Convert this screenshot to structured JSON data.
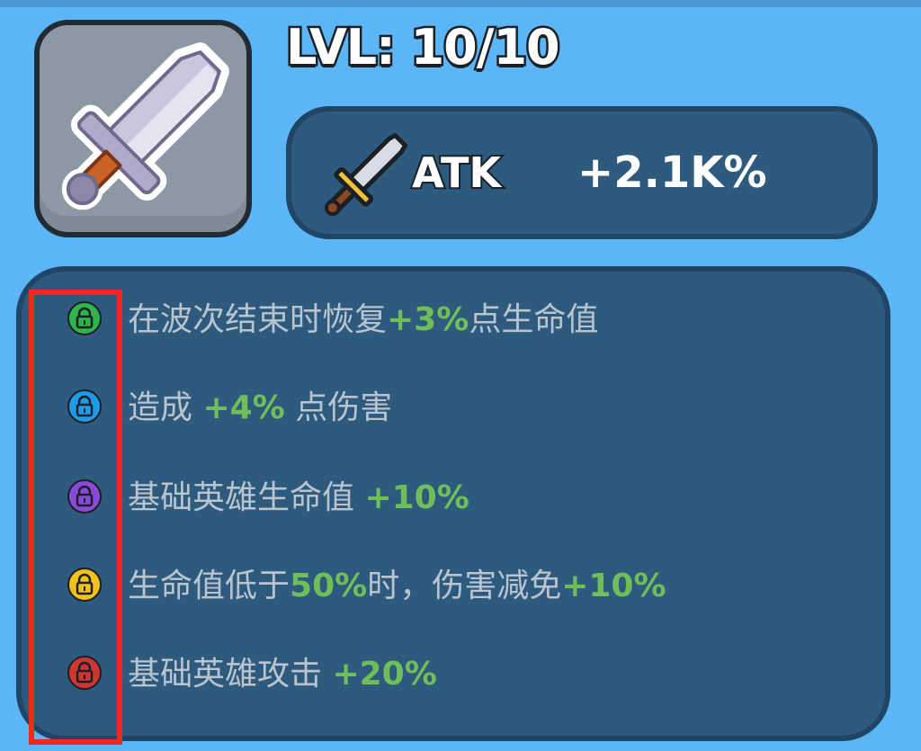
{
  "item": {
    "icon": "sword-icon"
  },
  "level": {
    "label": "LVL: 10/10"
  },
  "stat": {
    "icon": "small-sword-icon",
    "label": "ATK",
    "value": "+2.1K%"
  },
  "perks": [
    {
      "color": "#2fb34a",
      "icon": "lock-icon",
      "pre": "在波次结束时恢复",
      "value": "+3%",
      "post": "点生命值"
    },
    {
      "color": "#1e9ae6",
      "icon": "lock-icon",
      "pre": "造成 ",
      "value": "+4%",
      "post": " 点伤害"
    },
    {
      "color": "#8a49d6",
      "icon": "lock-icon",
      "pre": "基础英雄生命值 ",
      "value": "+10%",
      "post": ""
    },
    {
      "color": "#f1c21b",
      "icon": "lock-icon",
      "pre": "生命值低于",
      "value": "50%",
      "mid": "时，伤害减免",
      "value2": "+10%",
      "post": ""
    },
    {
      "color": "#cf3632",
      "icon": "lock-icon",
      "pre": "基础英雄攻击 ",
      "value": "+20%",
      "post": ""
    }
  ],
  "colors": {
    "background": "#5cb5f4",
    "panel": "#2e5a7e",
    "highlight": "#6fbe5a",
    "annotation_box": "#ee2a1a"
  }
}
